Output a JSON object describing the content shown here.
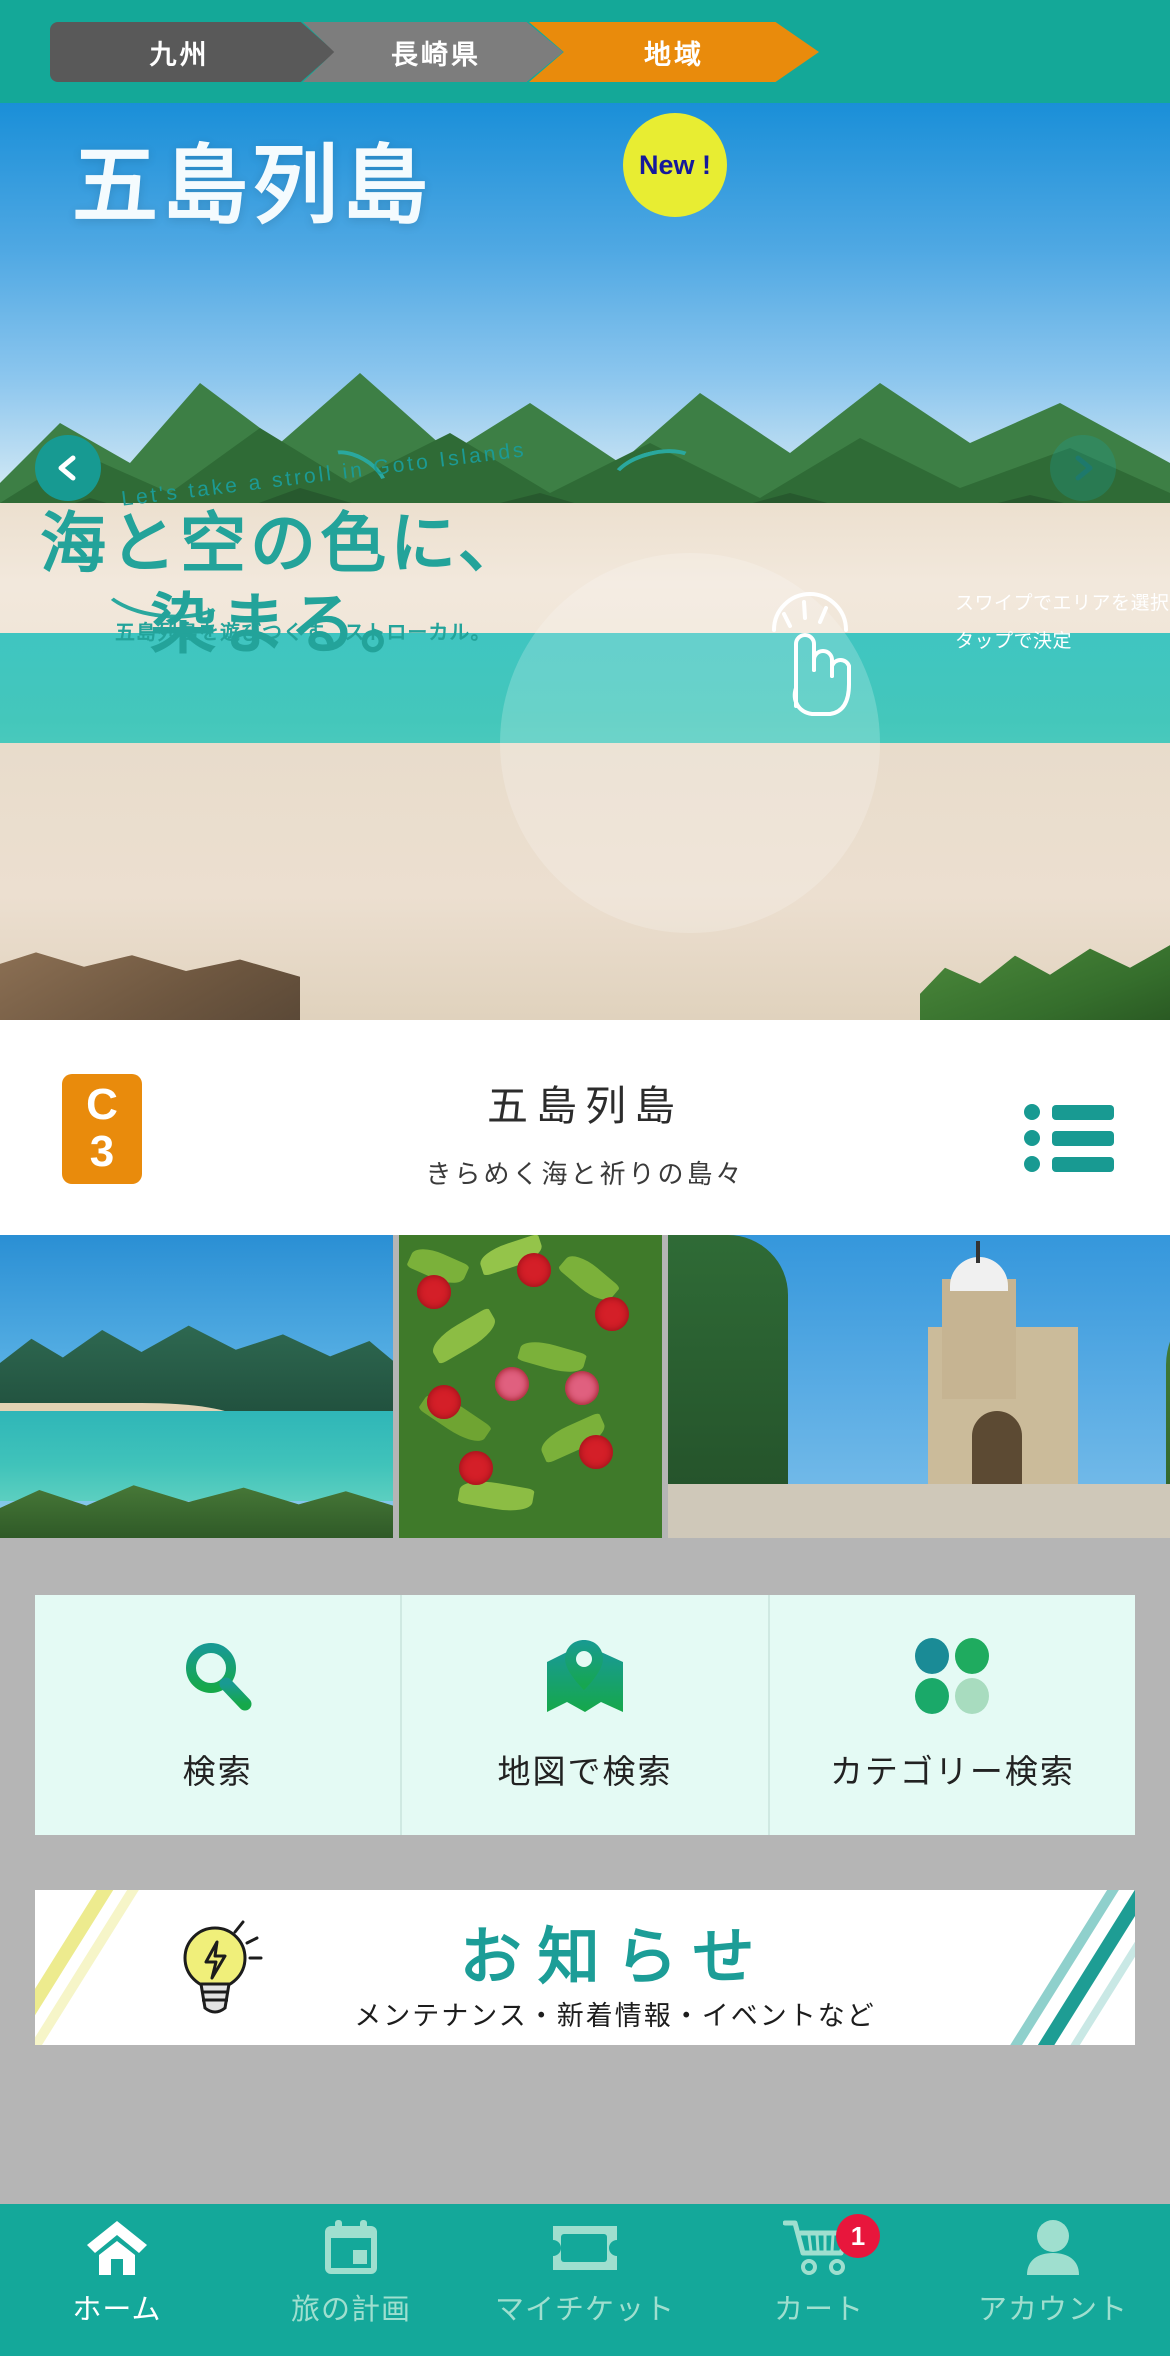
{
  "breadcrumb": {
    "items": [
      {
        "label": "九州",
        "state": "inactive"
      },
      {
        "label": "長崎県",
        "state": "inactive"
      },
      {
        "label": "地域",
        "state": "active"
      }
    ]
  },
  "hero": {
    "title": "五島列島",
    "new_badge": "New !",
    "tagline_en": "Let's take a stroll in Goto Islands",
    "tagline_jp_line1": "海と空の色に、",
    "tagline_jp_line2": "染まる。",
    "tagline_sub": "五島列島を遊びつくす、ストローカル。",
    "hint_line1": "スワイプでエリアを選択",
    "hint_line2": "タップで決定",
    "prev_icon": "chevron-left-icon",
    "next_icon": "chevron-right-icon",
    "hand_icon": "tap-hand-icon"
  },
  "info_card": {
    "code_letter": "C",
    "code_number": "3",
    "title": "五島列島",
    "subtitle": "きらめく海と祈りの島々",
    "list_icon": "list-menu-icon"
  },
  "thumbnails": [
    {
      "alt": "coastal-bay-photo"
    },
    {
      "alt": "camellia-flowers-photo"
    },
    {
      "alt": "stone-church-photo"
    }
  ],
  "actions": [
    {
      "label": "検索",
      "icon": "search-icon"
    },
    {
      "label": "地図で検索",
      "icon": "map-pin-icon"
    },
    {
      "label": "カテゴリー検索",
      "icon": "category-dots-icon"
    }
  ],
  "notice": {
    "title": "お知らせ",
    "subtitle": "メンテナンス・新着情報・イベントなど",
    "icon": "lightbulb-icon"
  },
  "bottom_nav": [
    {
      "label": "ホーム",
      "icon": "home-icon",
      "active": true,
      "badge": null
    },
    {
      "label": "旅の計画",
      "icon": "calendar-icon",
      "active": false,
      "badge": null
    },
    {
      "label": "マイチケット",
      "icon": "ticket-icon",
      "active": false,
      "badge": null
    },
    {
      "label": "カート",
      "icon": "cart-icon",
      "active": false,
      "badge": "1"
    },
    {
      "label": "アカウント",
      "icon": "account-icon",
      "active": false,
      "badge": null
    }
  ],
  "colors": {
    "brand_teal": "#14a89a",
    "accent_orange": "#e98b0c",
    "badge_yellow": "#e8ed32",
    "badge_red": "#e8163c",
    "page_bg": "#b5b5b5",
    "panel_mint": "#e4faf4"
  }
}
